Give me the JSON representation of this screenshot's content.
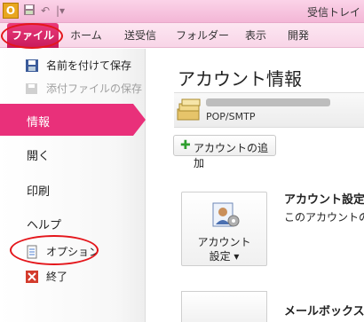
{
  "titlebar": {
    "app_icon": "O",
    "title": "受信トレイ"
  },
  "tabs": [
    {
      "label": "ファイル"
    },
    {
      "label": "ホーム"
    },
    {
      "label": "送受信"
    },
    {
      "label": "フォルダー"
    },
    {
      "label": "表示"
    },
    {
      "label": "開発"
    }
  ],
  "backstage": {
    "items": {
      "save_as": "名前を付けて保存",
      "save_attachments": "添付ファイルの保存",
      "info": "情報",
      "open": "開く",
      "print": "印刷",
      "help": "ヘルプ",
      "options": "オプション",
      "exit": "終了"
    }
  },
  "content": {
    "title": "アカウント情報",
    "account_type": "POP/SMTP",
    "add_account": "アカウントの追加",
    "settings_button_line1": "アカウント",
    "settings_button_line2": "設定 ▾",
    "settings_title": "アカウント設定",
    "settings_desc": "このアカウントの設",
    "mailbox_title": "メールボックスの"
  },
  "colors": {
    "accent": "#e9307a",
    "annotation": "#e4161b"
  }
}
